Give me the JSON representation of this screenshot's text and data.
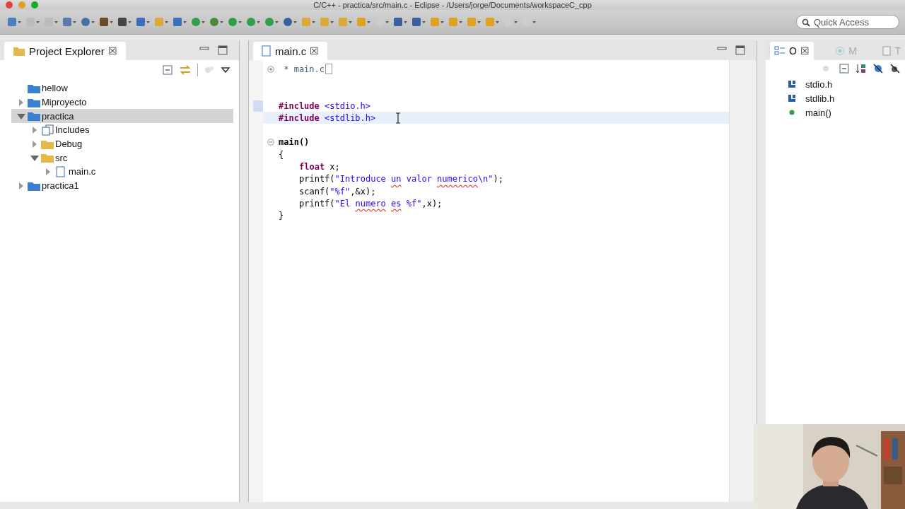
{
  "window": {
    "title": "C/C++ - practica/src/main.c - Eclipse - /Users/jorge/Documents/workspaceC_cpp"
  },
  "toolbar": {
    "quick_access": {
      "placeholder": "Quick Access"
    }
  },
  "project_explorer": {
    "title": "Project Explorer",
    "close": "☒",
    "tree": [
      {
        "label": "hellow",
        "kind": "closed-project",
        "selected": false
      },
      {
        "label": "Miproyecto",
        "kind": "c-project",
        "expanded": false,
        "selected": false
      },
      {
        "label": "practica",
        "kind": "c-project",
        "expanded": true,
        "selected": true,
        "children": [
          {
            "label": "Includes",
            "kind": "includes",
            "expanded": false,
            "selected": false
          },
          {
            "label": "Debug",
            "kind": "folder",
            "expanded": false,
            "selected": false
          },
          {
            "label": "src",
            "kind": "folder",
            "expanded": true,
            "selected": false,
            "children": [
              {
                "label": "main.c",
                "kind": "c-file",
                "expanded": false,
                "selected": false
              }
            ]
          }
        ]
      },
      {
        "label": "practica1",
        "kind": "c-project",
        "expanded": false,
        "selected": false
      }
    ]
  },
  "editor": {
    "tab": {
      "label": "main.c",
      "selected": true
    },
    "lines": [
      {
        "collapsed": true,
        "segments": [
          {
            "text": " * main.c",
            "kind": "comment"
          }
        ],
        "highlight": false
      },
      {
        "highlight": false
      },
      {
        "highlight": false
      },
      {
        "segments": [
          {
            "text": "#include",
            "kind": "keyword"
          },
          {
            "text": " <stdio.h>",
            "kind": "string"
          }
        ],
        "highlight": false,
        "marker": true
      },
      {
        "segments": [
          {
            "text": "#include",
            "kind": "keyword"
          },
          {
            "text": " <stdlib.h>",
            "kind": "string"
          }
        ],
        "highlight": true
      },
      {
        "highlight": false
      },
      {
        "collapsed": false,
        "segments": [
          {
            "text": "main()",
            "kind": "bold"
          }
        ],
        "highlight": false
      },
      {
        "segments": [
          {
            "text": "{",
            "kind": "plain"
          }
        ],
        "highlight": false
      },
      {
        "indent": true,
        "segments": [
          {
            "text": "float",
            "kind": "keyword"
          },
          {
            "text": " x;",
            "kind": "plain"
          }
        ],
        "highlight": false
      },
      {
        "indent": true,
        "segments": [
          {
            "text": "printf(",
            "kind": "plain"
          },
          {
            "text": "\"Introduce ",
            "kind": "string"
          },
          {
            "text": "un",
            "kind": "string",
            "misspelled": true
          },
          {
            "text": " valor ",
            "kind": "string"
          },
          {
            "text": "numerico",
            "kind": "string",
            "misspelled": true
          },
          {
            "text": "\\n\"",
            "kind": "string"
          },
          {
            "text": ");",
            "kind": "plain"
          }
        ],
        "highlight": false
      },
      {
        "indent": true,
        "segments": [
          {
            "text": "scanf(",
            "kind": "plain"
          },
          {
            "text": "\"%f\"",
            "kind": "string"
          },
          {
            "text": ",&x);",
            "kind": "plain"
          }
        ],
        "highlight": false
      },
      {
        "indent": true,
        "segments": [
          {
            "text": "printf(",
            "kind": "plain"
          },
          {
            "text": "\"El ",
            "kind": "string"
          },
          {
            "text": "numero",
            "kind": "string",
            "misspelled": true
          },
          {
            "text": " es",
            "kind": "string",
            "misspelled": true
          },
          {
            "text": " %f\"",
            "kind": "string"
          },
          {
            "text": ",x);",
            "kind": "plain"
          }
        ],
        "highlight": false
      },
      {
        "segments": [
          {
            "text": "}",
            "kind": "plain"
          }
        ],
        "highlight": false
      }
    ]
  },
  "outline": {
    "tabs": [
      {
        "label": "O",
        "kind": "outline",
        "selected": true
      },
      {
        "label": "M",
        "kind": "make",
        "selected": false
      },
      {
        "label": "T",
        "kind": "tasks",
        "selected": false
      }
    ],
    "close": "☒",
    "items": [
      {
        "label": "stdio.h",
        "kind": "include"
      },
      {
        "label": "stdlib.h",
        "kind": "include"
      },
      {
        "label": "main()",
        "kind": "function"
      }
    ]
  }
}
